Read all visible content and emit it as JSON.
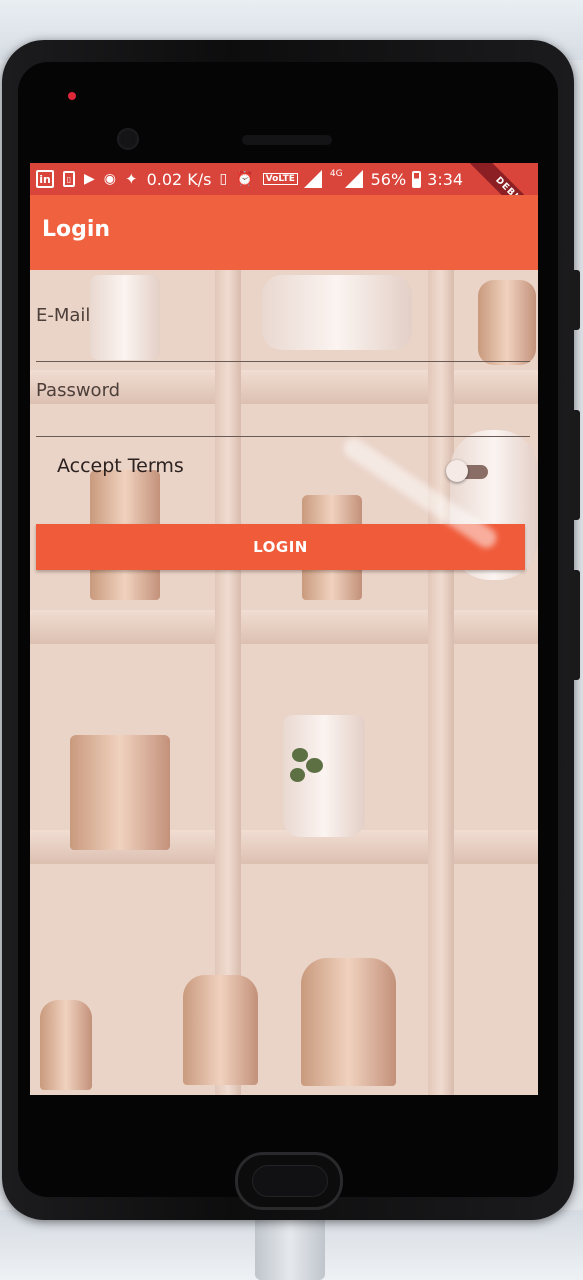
{
  "status_bar": {
    "speed": "0.02 K/s",
    "volte": "VoLTE",
    "network": "4G",
    "battery": "56%",
    "time": "3:34",
    "debug": "DEBUG",
    "notification_icons": [
      "linkedin-icon",
      "sim-icon",
      "play-store-icon",
      "record-icon",
      "twitter-icon"
    ]
  },
  "app_bar": {
    "title": "Login"
  },
  "form": {
    "email_label": "E-Mail",
    "password_label": "Password",
    "terms_label": "Accept Terms",
    "terms_accepted": false,
    "login_button": "LOGIN"
  },
  "colors": {
    "app_bar": "#f0613f",
    "status_bar": "#d9443b",
    "button": "#f05b3a"
  }
}
